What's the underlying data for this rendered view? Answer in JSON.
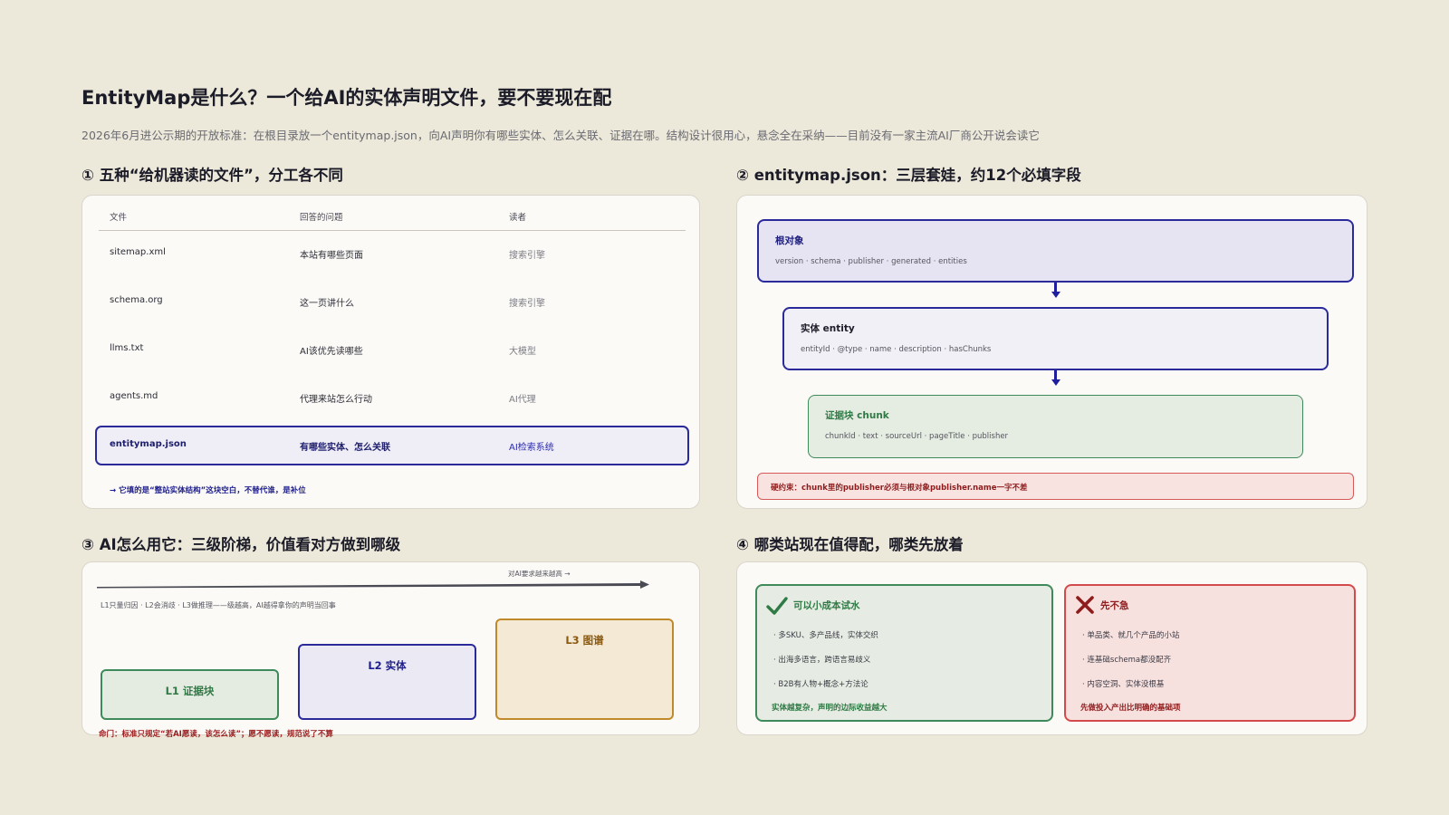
{
  "header": {
    "title": "EntityMap是什么？一个给AI的实体声明文件，要不要现在配",
    "subtitle": "2026年6月进公示期的开放标准：在根目录放一个entitymap.json，向AI声明你有哪些实体、怎么关联、证据在哪。结构设计很用心，悬念全在采纳——目前没有一家主流AI厂商公开说会读它"
  },
  "panel1": {
    "title": "① 五种“给机器读的文件”，分工各不同",
    "columns": [
      "文件",
      "回答的问题",
      "读者"
    ],
    "rows": [
      [
        "sitemap.xml",
        "本站有哪些页面",
        "搜索引擎"
      ],
      [
        "schema.org",
        "这一页讲什么",
        "搜索引擎"
      ],
      [
        "llms.txt",
        "AI该优先读哪些",
        "大模型"
      ],
      [
        "agents.md",
        "代理来站怎么行动",
        "AI代理"
      ],
      [
        "entitymap.json",
        "有哪些实体、怎么关联",
        "AI检索系统"
      ]
    ],
    "note": "→ 它填的是“整站实体结构”这块空白，不替代谁，是补位"
  },
  "panel2": {
    "title": "② entitymap.json：三层套娃，约12个必填字段",
    "layers": [
      {
        "title": "根对象",
        "fields": "version · schema · publisher · generated · entities"
      },
      {
        "title": "实体 entity",
        "fields": "entityId · @type · name · description · hasChunks"
      },
      {
        "title": "证据块 chunk",
        "fields": "chunkId · text · sourceUrl · pageTitle · publisher"
      }
    ],
    "constraint": "硬约束：chunk里的publisher必须与根对象publisher.name一字不差"
  },
  "panel3": {
    "title": "③ AI怎么用它：三级阶梯，价值看对方做到哪级",
    "axis_label": "对AI要求越来越高 →",
    "caption": "L1只量归因 · L2会消歧 · L3做推理——级越高，AI越得拿你的声明当回事",
    "steps": [
      "L1 证据块",
      "L2 实体",
      "L3 图谱"
    ],
    "note": "命门：标准只规定“若AI愿读，该怎么读”；愿不愿读，规范说了不算"
  },
  "panel4": {
    "title": "④ 哪类站现在值得配，哪类先放着",
    "yes": {
      "title": "可以小成本试水",
      "items": [
        "· 多SKU、多产品线，实体交织",
        "· 出海多语言，跨语言易歧义",
        "· B2B有人物+概念+方法论"
      ],
      "foot": "实体越复杂，声明的边际收益越大"
    },
    "no": {
      "title": "先不急",
      "items": [
        "· 单品类、就几个产品的小站",
        "· 连基础schema都没配齐",
        "· 内容空洞、实体没根基"
      ],
      "foot": "先做投入产出比明确的基础项"
    }
  },
  "colors": {
    "background": "#ece8da",
    "accent_navy": "#2a2a9a",
    "green": "#2f7a45",
    "red": "#c42b2b",
    "amber": "#b87b1a"
  }
}
